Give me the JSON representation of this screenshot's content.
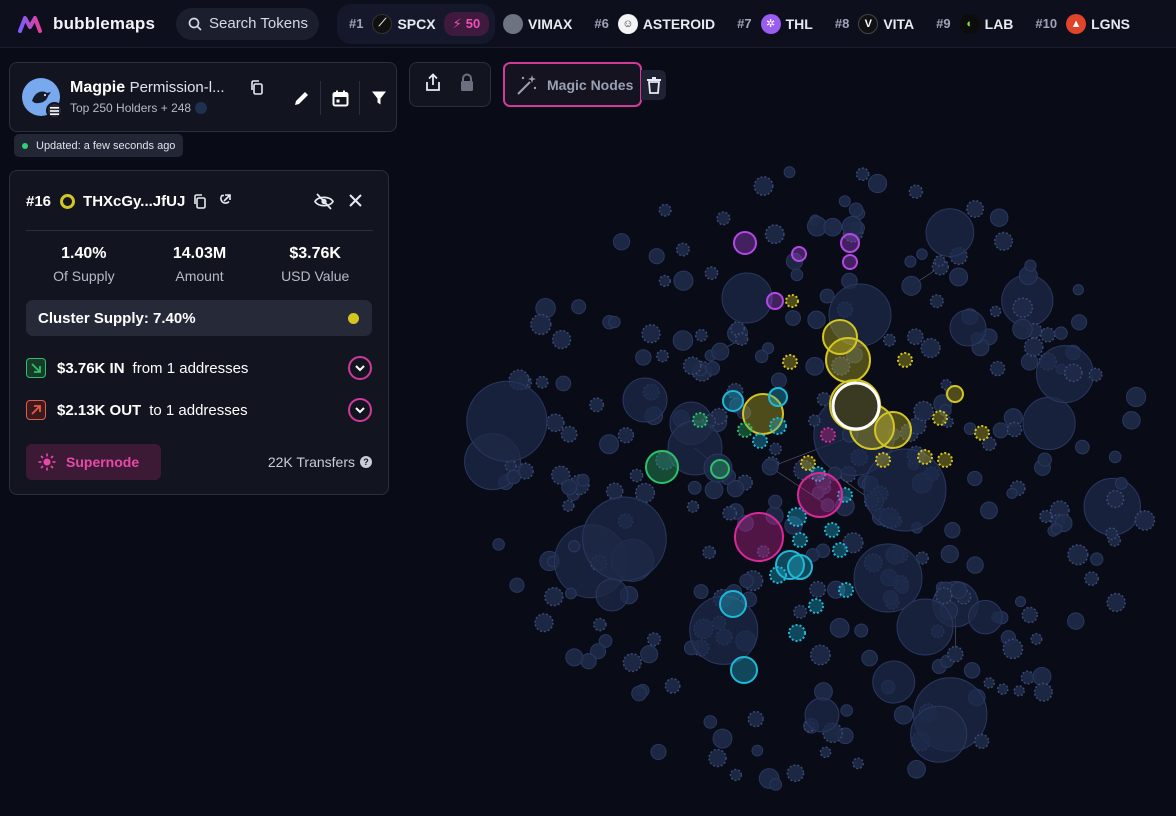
{
  "app": {
    "logo_text": "bubblemaps",
    "search_placeholder": "Search Tokens"
  },
  "trending": [
    {
      "rank": "#1",
      "symbol": "SPCX",
      "boost": "50",
      "icon_color": "#101010"
    },
    {
      "rank": "",
      "symbol": "VIMAX",
      "icon_color": "#6d7380"
    },
    {
      "rank": "#6",
      "symbol": "ASTEROID",
      "icon_color": "#f4f4f4"
    },
    {
      "rank": "#7",
      "symbol": "THL",
      "icon_color": "#9b5cf0"
    },
    {
      "rank": "#8",
      "symbol": "VITA",
      "icon_color": "#111111"
    },
    {
      "rank": "#9",
      "symbol": "LAB",
      "icon_color": "#0c0c0c"
    },
    {
      "rank": "#10",
      "symbol": "LGNS",
      "icon_color": "#e0442a"
    }
  ],
  "token": {
    "name": "Magpie",
    "subtitle": "Permission-l...",
    "holders": "Top 250 Holders + 248",
    "updated": "Updated: a few seconds ago"
  },
  "toolbar": {
    "magic_nodes": "Magic Nodes"
  },
  "selected": {
    "rank": "#16",
    "address": "THXcGy...JfUJ",
    "supply_value": "1.40%",
    "supply_label": "Of Supply",
    "amount_value": "14.03M",
    "amount_label": "Amount",
    "usd_value": "$3.76K",
    "usd_label": "USD Value",
    "cluster_supply": "Cluster Supply: 7.40%",
    "in_amount": "$3.76K IN",
    "in_text": "from 1 addresses",
    "out_amount": "$2.13K OUT",
    "out_text": "to 1 addresses",
    "supernode": "Supernode",
    "transfers": "22K Transfers"
  },
  "colors": {
    "accent": "#d03a9a",
    "cluster_yellow": "#d4c522",
    "cluster_purple": "#b348e6",
    "cluster_cyan": "#1fb8d6",
    "cluster_magenta": "#d8289a",
    "cluster_green": "#2fbf6a",
    "inflow": "#2fbf6a",
    "outflow": "#e55a4a",
    "background": "#090b17"
  }
}
